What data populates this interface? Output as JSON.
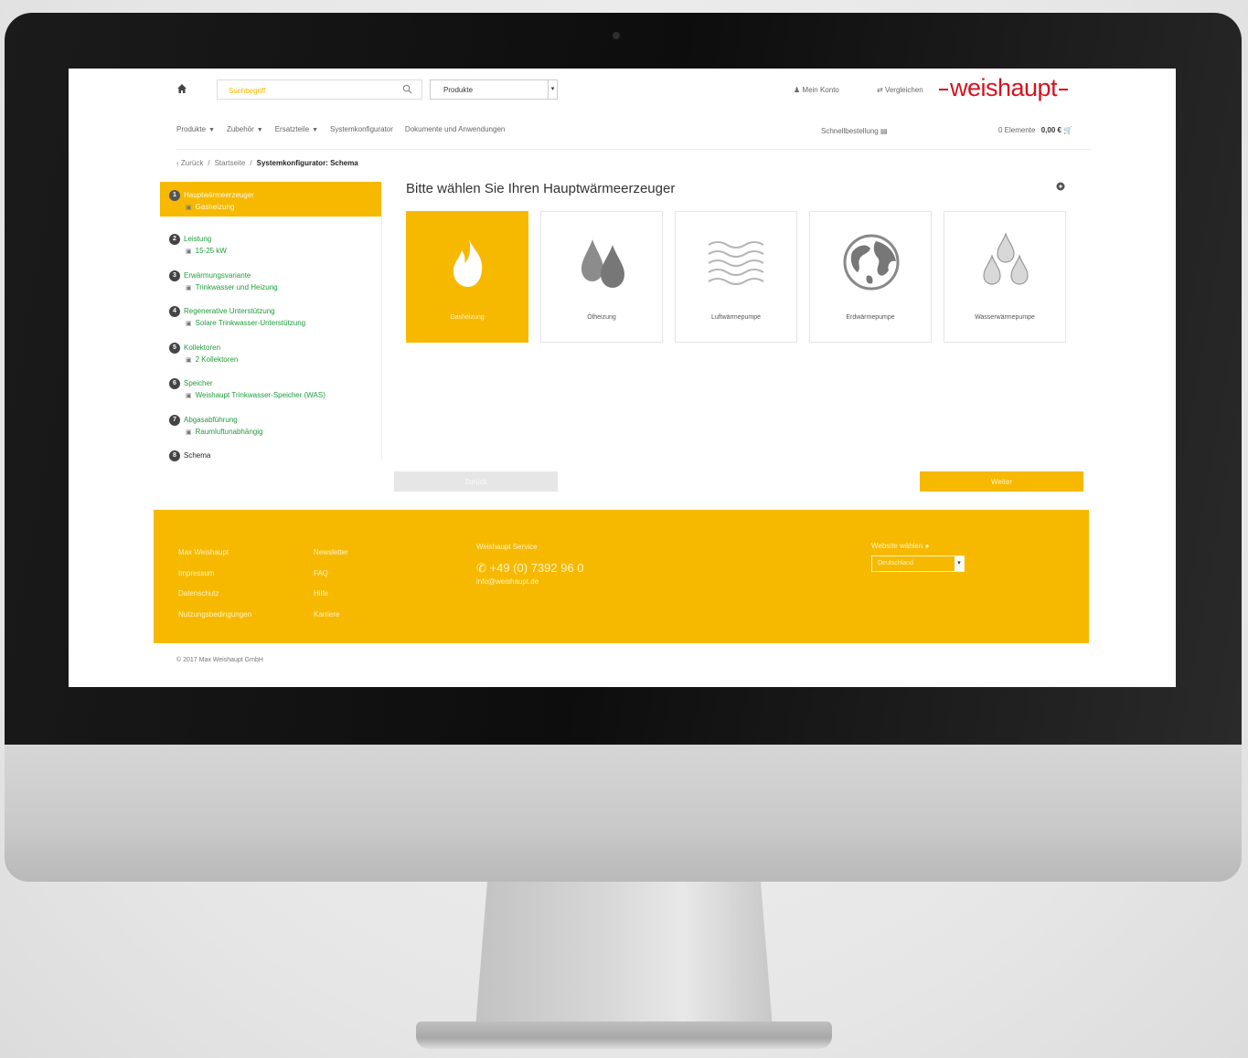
{
  "header": {
    "search_placeholder": "Suchbegriff",
    "product_select": "Produkte",
    "account": "Mein Konto",
    "compare": "Vergleichen",
    "logo": "weishaupt"
  },
  "nav": {
    "items": [
      "Produkte",
      "Zubehör",
      "Ersatzteile",
      "Systemkonfigurator",
      "Dokumente und Anwendungen"
    ],
    "quick_order": "Schnellbestellung",
    "cart_count": "0 Elemente",
    "cart_total": "0,00 €"
  },
  "breadcrumb": {
    "back": "Zurück",
    "home": "Startseite",
    "current": "Systemkonfigurator: Schema"
  },
  "steps": [
    {
      "num": "1",
      "title": "Hauptwärmeerzeuger",
      "sub": "Gasheizung"
    },
    {
      "num": "2",
      "title": "Leistung",
      "sub": "15-25 kW"
    },
    {
      "num": "3",
      "title": "Erwärmungsvariante",
      "sub": "Trinkwasser und Heizung"
    },
    {
      "num": "4",
      "title": "Regenerative Unterstützung",
      "sub": "Solare Trinkwasser-Unterstützung"
    },
    {
      "num": "5",
      "title": "Kollektoren",
      "sub": "2 Kollektoren"
    },
    {
      "num": "6",
      "title": "Speicher",
      "sub": "Weishaupt Trinkwasser-Speicher (WAS)"
    },
    {
      "num": "7",
      "title": "Abgasabführung",
      "sub": "Raumluftunabhängig"
    },
    {
      "num": "8",
      "title": "Schema"
    }
  ],
  "main": {
    "title": "Bitte wählen Sie Ihren Hauptwärmeerzeuger",
    "tiles": [
      {
        "label": "Gasheizung",
        "icon": "flame-icon",
        "selected": true
      },
      {
        "label": "Ölheizung",
        "icon": "oil-drops-icon",
        "selected": false
      },
      {
        "label": "Luftwärmepumpe",
        "icon": "air-waves-icon",
        "selected": false
      },
      {
        "label": "Erdwärmepumpe",
        "icon": "globe-icon",
        "selected": false
      },
      {
        "label": "Wasserwärmepumpe",
        "icon": "water-drops-icon",
        "selected": false
      }
    ],
    "back_button": "Zurück",
    "next_button": "Weiter"
  },
  "footer": {
    "col1": [
      "Max Weishaupt",
      "Impressum",
      "Datenschutz",
      "Nutzungsbedingungen"
    ],
    "col2": [
      "Newsletter",
      "FAQ",
      "Hilfe",
      "Karriere"
    ],
    "service_title": "Weishaupt Service",
    "service_phone": "+49 (0) 7392 96 0",
    "service_mail": "info@weishaupt.de",
    "site_label": "Website wählen",
    "site_select": "Deutschland"
  },
  "copyright": "© 2017 Max Weishaupt GmbH",
  "colors": {
    "accent": "#f6b900",
    "brand": "#d5121e",
    "step_text": "#1f9d3a"
  }
}
